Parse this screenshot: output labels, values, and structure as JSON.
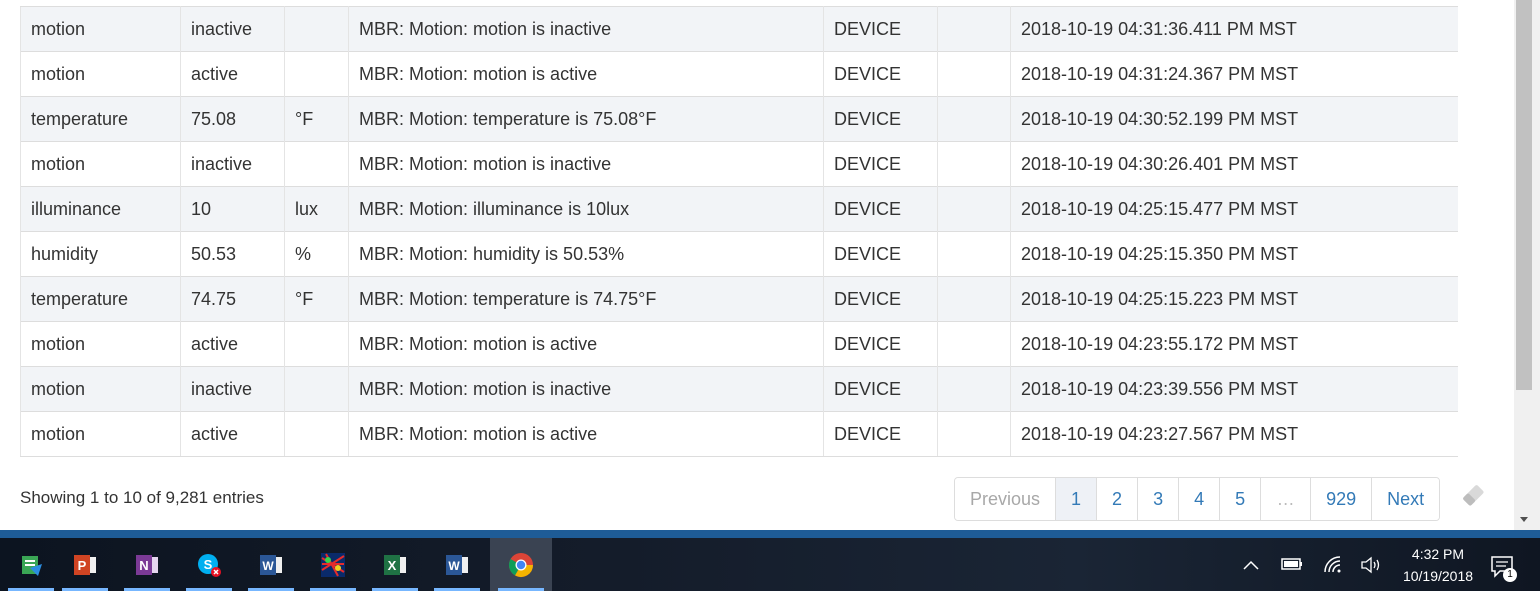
{
  "table": {
    "rows": [
      {
        "name": "motion",
        "value": "inactive",
        "unit": "",
        "description": "MBR: Motion: motion is inactive",
        "type": "DEVICE",
        "extra": "",
        "date": "2018-10-19 04:31:36.411 PM MST"
      },
      {
        "name": "motion",
        "value": "active",
        "unit": "",
        "description": "MBR: Motion: motion is active",
        "type": "DEVICE",
        "extra": "",
        "date": "2018-10-19 04:31:24.367 PM MST"
      },
      {
        "name": "temperature",
        "value": "75.08",
        "unit": "°F",
        "description": "MBR: Motion: temperature is 75.08°F",
        "type": "DEVICE",
        "extra": "",
        "date": "2018-10-19 04:30:52.199 PM MST"
      },
      {
        "name": "motion",
        "value": "inactive",
        "unit": "",
        "description": "MBR: Motion: motion is inactive",
        "type": "DEVICE",
        "extra": "",
        "date": "2018-10-19 04:30:26.401 PM MST"
      },
      {
        "name": "illuminance",
        "value": "10",
        "unit": "lux",
        "description": "MBR: Motion: illuminance is 10lux",
        "type": "DEVICE",
        "extra": "",
        "date": "2018-10-19 04:25:15.477 PM MST"
      },
      {
        "name": "humidity",
        "value": "50.53",
        "unit": "%",
        "description": "MBR: Motion: humidity is 50.53%",
        "type": "DEVICE",
        "extra": "",
        "date": "2018-10-19 04:25:15.350 PM MST"
      },
      {
        "name": "temperature",
        "value": "74.75",
        "unit": "°F",
        "description": "MBR: Motion: temperature is 74.75°F",
        "type": "DEVICE",
        "extra": "",
        "date": "2018-10-19 04:25:15.223 PM MST"
      },
      {
        "name": "motion",
        "value": "active",
        "unit": "",
        "description": "MBR: Motion: motion is active",
        "type": "DEVICE",
        "extra": "",
        "date": "2018-10-19 04:23:55.172 PM MST"
      },
      {
        "name": "motion",
        "value": "inactive",
        "unit": "",
        "description": "MBR: Motion: motion is inactive",
        "type": "DEVICE",
        "extra": "",
        "date": "2018-10-19 04:23:39.556 PM MST"
      },
      {
        "name": "motion",
        "value": "active",
        "unit": "",
        "description": "MBR: Motion: motion is active",
        "type": "DEVICE",
        "extra": "",
        "date": "2018-10-19 04:23:27.567 PM MST"
      }
    ]
  },
  "info": "Showing 1 to 10 of 9,281 entries",
  "pagination": {
    "previous": "Previous",
    "pages": [
      "1",
      "2",
      "3",
      "4",
      "5"
    ],
    "ellipsis": "…",
    "last": "929",
    "next": "Next",
    "current": "1"
  },
  "taskbar": {
    "apps": [
      "file-explorer-icon",
      "powerpoint-icon",
      "onenote-icon",
      "skype-icon",
      "word-icon",
      "network-app-icon",
      "excel-icon",
      "word-icon",
      "chrome-icon"
    ],
    "clock_time": "4:32 PM",
    "clock_date": "10/19/2018",
    "notification_count": "1"
  },
  "colors": {
    "link": "#337ab7",
    "row_stripe": "#f2f4f7",
    "taskbar_accent": "#1e5c97"
  }
}
